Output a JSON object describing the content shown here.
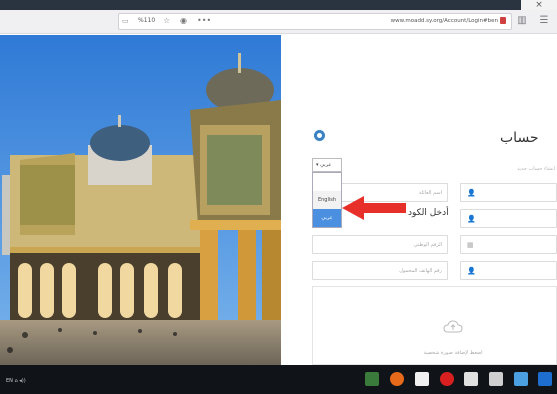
{
  "browser": {
    "close_label": "×",
    "zoom_label": "%110",
    "url": "www.moadd.sy.org/Account/Login#ben",
    "icons": {
      "reader": "reader-icon",
      "page_action": "bookmark-icon",
      "pocket": "pocket-icon",
      "more": "more-icon",
      "lock": "lock-icon",
      "sidebar": "sidebar-icon",
      "menu": "hamburger-menu-icon"
    }
  },
  "form": {
    "title": "حساب",
    "subtitle": "انشاء حساب جديد",
    "fields_right": [
      {
        "icon": "user-icon",
        "placeholder": ""
      },
      {
        "icon": "user-icon",
        "placeholder": ""
      },
      {
        "icon": "calendar-icon",
        "placeholder": ""
      },
      {
        "icon": "user-icon",
        "placeholder": ""
      }
    ],
    "fields_middle": [
      {
        "placeholder": "اسم العائلة"
      },
      {
        "placeholder": "الرقم الوطني"
      },
      {
        "placeholder": "رقم الهاتف المحمول"
      }
    ],
    "captcha_label": "أدخل الكود",
    "language_select": {
      "selected": "عربي",
      "options": [
        "",
        "English",
        "عربي"
      ]
    },
    "upload_hint": "اضغط لإضافة صورة شخصية"
  },
  "taskbar": {
    "left_text": "EN  ⌂  ◂))  ",
    "apps": [
      "explorer",
      "firefox",
      "files",
      "opera",
      "mail",
      "store",
      "photos",
      "edge"
    ]
  },
  "colors": {
    "accent": "#3a82c4",
    "arrow": "#e8302a",
    "dropdown_highlight": "#4a8fe0"
  }
}
